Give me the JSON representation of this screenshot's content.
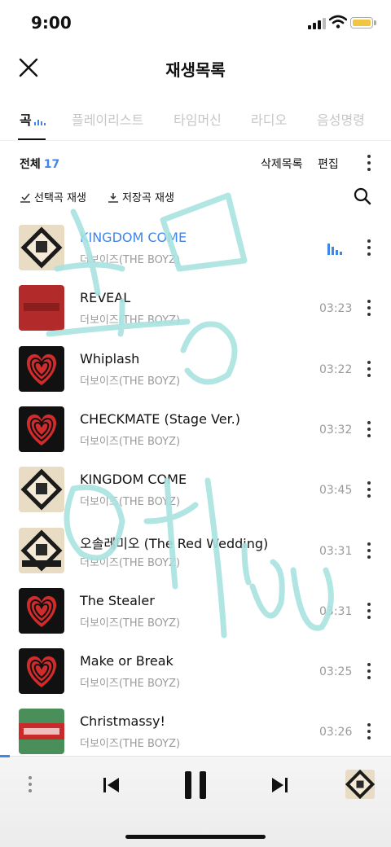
{
  "status": {
    "time": "9:00"
  },
  "header": {
    "title": "재생목록"
  },
  "tabs": [
    {
      "label": "곡",
      "active": true
    },
    {
      "label": "플레이리스트"
    },
    {
      "label": "타임머신"
    },
    {
      "label": "라디오"
    },
    {
      "label": "음성명령"
    }
  ],
  "toolbar": {
    "all_label": "전체",
    "count": "17",
    "deleted_label": "삭제목록",
    "edit_label": "편집"
  },
  "actions": {
    "play_selected": "선택곡 재생",
    "play_saved": "저장곡 재생"
  },
  "tracks": [
    {
      "title": "KINGDOM COME",
      "artist": "더보이즈(THE BOYZ)",
      "duration": "",
      "playing": true,
      "art": "kingdom"
    },
    {
      "title": "REVEAL",
      "artist": "더보이즈(THE BOYZ)",
      "duration": "03:23",
      "art": "reveal"
    },
    {
      "title": "Whiplash",
      "artist": "더보이즈(THE BOYZ)",
      "duration": "03:22",
      "art": "heart"
    },
    {
      "title": "CHECKMATE (Stage Ver.)",
      "artist": "더보이즈(THE BOYZ)",
      "duration": "03:32",
      "art": "heart"
    },
    {
      "title": "KINGDOM COME",
      "artist": "더보이즈(THE BOYZ)",
      "duration": "03:45",
      "art": "kingdom"
    },
    {
      "title": "오솔레미오 (The Red Wedding)",
      "artist": "더보이즈(THE BOYZ)",
      "duration": "03:31",
      "art": "reborn"
    },
    {
      "title": "The Stealer",
      "artist": "더보이즈(THE BOYZ)",
      "duration": "03:31",
      "art": "heart"
    },
    {
      "title": "Make or Break",
      "artist": "더보이즈(THE BOYZ)",
      "duration": "03:25",
      "art": "heart"
    },
    {
      "title": "Christmassy!",
      "artist": "더보이즈(THE BOYZ)",
      "duration": "03:26",
      "art": "christmas"
    }
  ],
  "colors": {
    "accent": "#3f86e6",
    "scribble": "#a8e3e0",
    "battery": "#f2c443"
  }
}
